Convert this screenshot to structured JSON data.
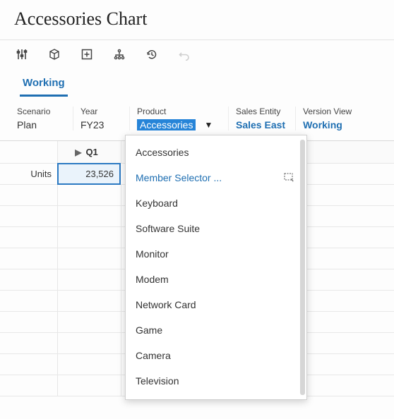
{
  "title": "Accessories Chart",
  "toolbar_icons": [
    "sliders",
    "cube",
    "add-note",
    "hierarchy",
    "history",
    "undo"
  ],
  "tabs": [
    {
      "label": "Working",
      "active": true
    }
  ],
  "dimensions": {
    "scenario": {
      "label": "Scenario",
      "value": "Plan"
    },
    "year": {
      "label": "Year",
      "value": "FY23"
    },
    "product": {
      "label": "Product",
      "value": "Accessories"
    },
    "sales_entity": {
      "label": "Sales Entity",
      "value": "Sales East"
    },
    "version_view": {
      "label": "Version View",
      "value": "Working"
    }
  },
  "grid": {
    "col_header": "Q1",
    "row_header": "Units",
    "value": "23,526"
  },
  "product_menu": {
    "items": [
      {
        "label": "Accessories",
        "accent": false
      },
      {
        "label": "Member Selector ...",
        "accent": true,
        "cursor_icon": true
      },
      {
        "label": "Keyboard"
      },
      {
        "label": "Software Suite"
      },
      {
        "label": "Monitor"
      },
      {
        "label": "Modem"
      },
      {
        "label": "Network Card"
      },
      {
        "label": "Game"
      },
      {
        "label": "Camera"
      },
      {
        "label": "Television"
      }
    ]
  }
}
